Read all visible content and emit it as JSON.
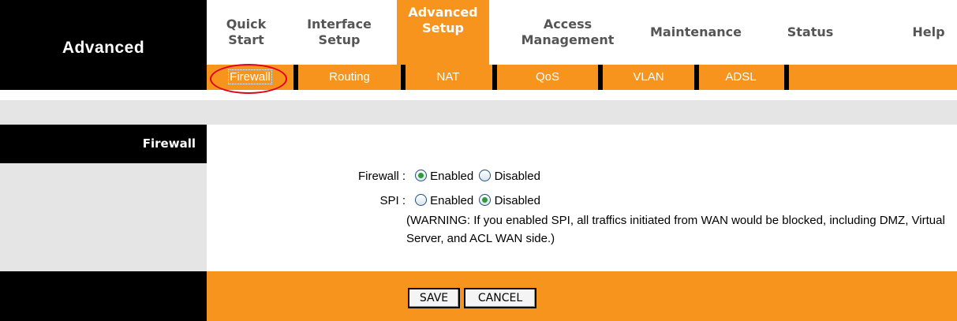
{
  "brand": {
    "title": "Advanced"
  },
  "mainnav": [
    {
      "label_line1": "Quick",
      "label_line2": "Start",
      "active": false
    },
    {
      "label_line1": "Interface",
      "label_line2": "Setup",
      "active": false
    },
    {
      "label_line1": "Advanced",
      "label_line2": "Setup",
      "active": true
    },
    {
      "label_line1": "Access",
      "label_line2": "Management",
      "active": false
    },
    {
      "label_line1": "Maintenance",
      "label_line2": "",
      "active": false
    },
    {
      "label_line1": "Status",
      "label_line2": "",
      "active": false
    },
    {
      "label_line1": "Help",
      "label_line2": "",
      "active": false
    }
  ],
  "subnav": [
    {
      "label": "Firewall",
      "current": true
    },
    {
      "label": "Routing",
      "current": false
    },
    {
      "label": "NAT",
      "current": false
    },
    {
      "label": "QoS",
      "current": false
    },
    {
      "label": "VLAN",
      "current": false
    },
    {
      "label": "ADSL",
      "current": false
    }
  ],
  "section": {
    "title": "Firewall"
  },
  "form": {
    "firewall_label": "Firewall :",
    "spi_label": "SPI :",
    "firewall_enabled_label": "Enabled",
    "firewall_disabled_label": "Disabled",
    "firewall_value": "Enabled",
    "spi_enabled_label": "Enabled",
    "spi_disabled_label": "Disabled",
    "spi_value": "Disabled",
    "warning": "(WARNING: If you enabled SPI, all traffics initiated from WAN would be blocked, including DMZ, Virtual Server, and ACL WAN side.)"
  },
  "buttons": {
    "save": "SAVE",
    "cancel": "CANCEL"
  },
  "colors": {
    "accent": "#f7941d",
    "dark": "#000000",
    "panel": "#e5e5e5",
    "highlight": "#e0001b"
  }
}
